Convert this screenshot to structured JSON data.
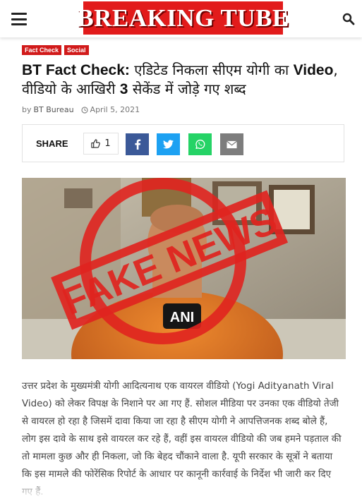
{
  "site": {
    "logo_text": "BREAKING TUBE"
  },
  "categories": [
    "Fact Check",
    "Social"
  ],
  "article": {
    "title_bold_1": "BT Fact Check:",
    "title_part_1": " एडिटेड निकला सीएम योगी का ",
    "title_bold_2": "Video",
    "title_part_2": ", वीडियो के आखिरी ",
    "title_bold_3": "3",
    "title_part_3": " सेकेंड में जोड़े गए शब्द",
    "by_label": "by",
    "author": "BT Bureau",
    "date": "April 5, 2021",
    "body": "उत्तर प्रदेश के मुख्यमंत्री योगी आदित्यनाथ एक वायरल वीडियो (Yogi Adityanath Viral Video) को लेकर विपक्ष के निशाने पर आ गए हैं. सोशल मीडिया पर उनका एक वीडियो तेजी से वायरल हो रहा है जिसमें दावा किया जा रहा है सीएम योगी ने आपत्तिजनक शब्द बोले हैं, लोग इस दावे के साथ इसे वायरल कर रहे हैं, वहीं इस वायरल वीडियो की जब हमने पड़ताल की तो मामला कुछ और ही निकला, जो कि बेहद चौंकाने वाला है. यूपी सरकार के सूत्रों ने बताया कि इस मामले की फोरेंसिक रिपोर्ट के आधार पर कानूनी कार्रवाई के निर्देश भी जारी कर दिए गए हैं."
  },
  "share": {
    "label": "SHARE",
    "like_count": "1"
  },
  "image": {
    "stamp_text": "FAKE NEWS",
    "mic_text": "ANI"
  },
  "colors": {
    "brand_red": "#e21b1b",
    "facebook": "#3b5998",
    "twitter": "#1da1f2",
    "whatsapp": "#25d366",
    "email": "#7d7d7d"
  },
  "icons": [
    "hamburger-menu-icon",
    "search-icon",
    "clock-icon",
    "thumbs-up-icon",
    "facebook-icon",
    "twitter-icon",
    "whatsapp-icon",
    "email-icon"
  ]
}
